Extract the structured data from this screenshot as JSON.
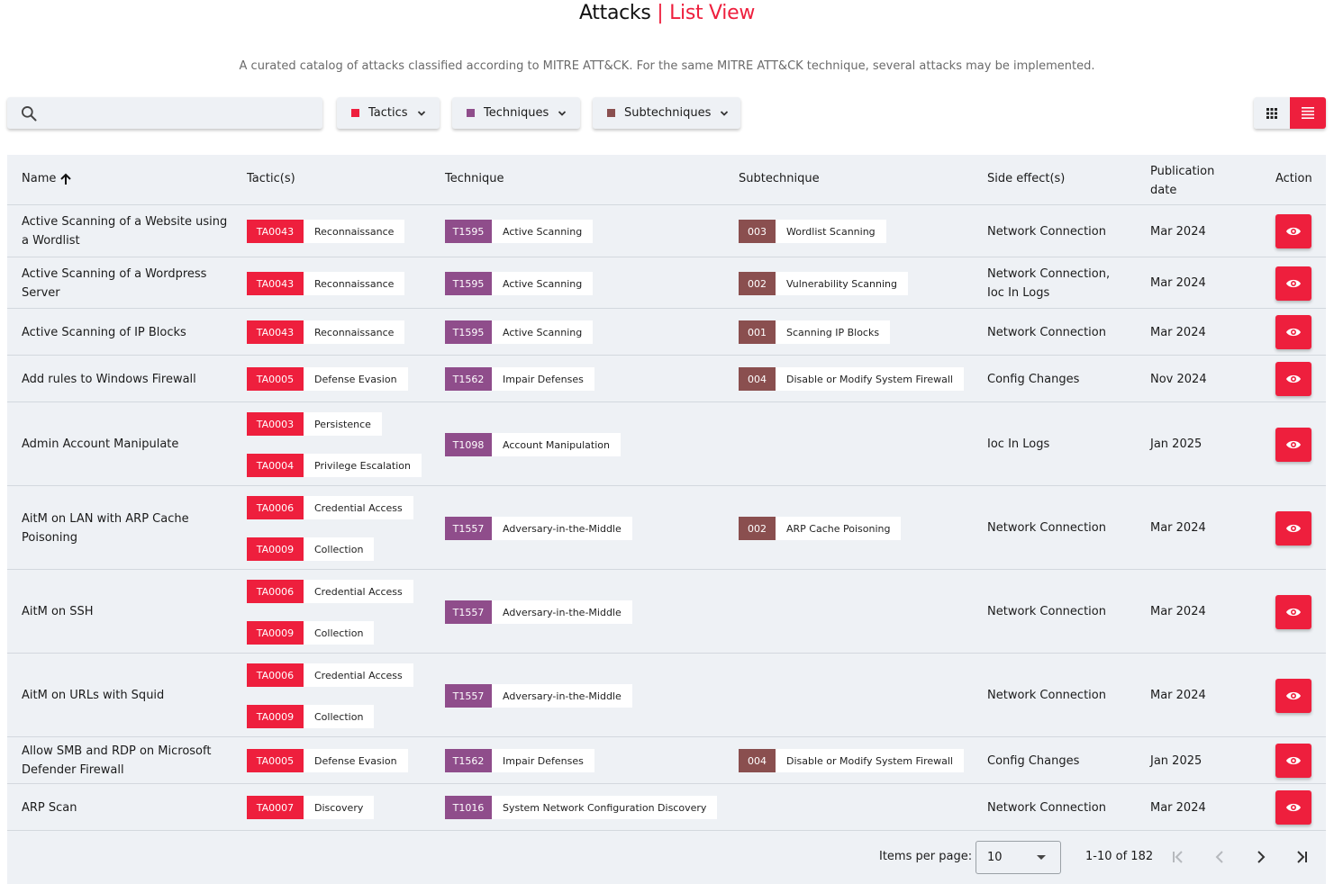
{
  "header": {
    "title_main": "Attacks",
    "title_sep": "|",
    "title_view": "List View",
    "subtitle": "A curated catalog of attacks classified according to MITRE ATT&CK. For the same MITRE ATT&CK technique, several attacks may be implemented."
  },
  "search": {
    "placeholder": "",
    "value": "",
    "icon": "search-icon"
  },
  "filters": [
    {
      "label": "Tactics",
      "color": "#ee1f3d"
    },
    {
      "label": "Techniques",
      "color": "#8f4d8b"
    },
    {
      "label": "Subtechniques",
      "color": "#8a4f4f"
    }
  ],
  "view_toggle": {
    "grid_icon": "grid-icon",
    "list_icon": "list-icon",
    "active": "list"
  },
  "colors": {
    "accent": "#ee1f3d",
    "tactic": "#ee1f3d",
    "technique": "#8f4d8b",
    "subtechnique": "#8a4f4f",
    "table_bg": "#eef1f5"
  },
  "table": {
    "columns": {
      "name": "Name",
      "tactics": "Tactic(s)",
      "technique": "Technique",
      "subtechnique": "Subtechnique",
      "side_effects": "Side effect(s)",
      "publication_1": "Publication",
      "publication_2": "date",
      "action": "Action"
    },
    "sort": {
      "column": "Name",
      "direction": "ascending"
    },
    "rows": [
      {
        "name1": "Active Scanning of a Website using",
        "name2": "a Wordlist",
        "tactics": [
          {
            "code": "TA0043",
            "label": "Reconnaissance"
          }
        ],
        "technique": {
          "code": "T1595",
          "label": "Active Scanning"
        },
        "subtechnique": {
          "code": "003",
          "label": "Wordlist Scanning"
        },
        "side1": "Network Connection",
        "side2": "",
        "date": "Mar 2024"
      },
      {
        "name1": "Active Scanning of a Wordpress",
        "name2": "Server",
        "tactics": [
          {
            "code": "TA0043",
            "label": "Reconnaissance"
          }
        ],
        "technique": {
          "code": "T1595",
          "label": "Active Scanning"
        },
        "subtechnique": {
          "code": "002",
          "label": "Vulnerability Scanning"
        },
        "side1": "Network Connection,",
        "side2": "Ioc In Logs",
        "date": "Mar 2024"
      },
      {
        "name1": "Active Scanning of IP Blocks",
        "name2": "",
        "tactics": [
          {
            "code": "TA0043",
            "label": "Reconnaissance"
          }
        ],
        "technique": {
          "code": "T1595",
          "label": "Active Scanning"
        },
        "subtechnique": {
          "code": "001",
          "label": "Scanning IP Blocks"
        },
        "side1": "Network Connection",
        "side2": "",
        "date": "Mar 2024"
      },
      {
        "name1": "Add rules to Windows Firewall",
        "name2": "",
        "tactics": [
          {
            "code": "TA0005",
            "label": "Defense Evasion"
          }
        ],
        "technique": {
          "code": "T1562",
          "label": "Impair Defenses"
        },
        "subtechnique": {
          "code": "004",
          "label": "Disable or Modify System Firewall"
        },
        "side1": "Config Changes",
        "side2": "",
        "date": "Nov 2024"
      },
      {
        "name1": "Admin Account Manipulate",
        "name2": "",
        "tactics": [
          {
            "code": "TA0003",
            "label": "Persistence"
          },
          {
            "code": "TA0004",
            "label": "Privilege Escalation"
          }
        ],
        "technique": {
          "code": "T1098",
          "label": "Account Manipulation"
        },
        "subtechnique": null,
        "side1": "Ioc In Logs",
        "side2": "",
        "date": "Jan 2025"
      },
      {
        "name1": "AitM on LAN with ARP Cache",
        "name2": "Poisoning",
        "tactics": [
          {
            "code": "TA0006",
            "label": "Credential Access"
          },
          {
            "code": "TA0009",
            "label": "Collection"
          }
        ],
        "technique": {
          "code": "T1557",
          "label": "Adversary-in-the-Middle"
        },
        "subtechnique": {
          "code": "002",
          "label": "ARP Cache Poisoning"
        },
        "side1": "Network Connection",
        "side2": "",
        "date": "Mar 2024"
      },
      {
        "name1": "AitM on SSH",
        "name2": "",
        "tactics": [
          {
            "code": "TA0006",
            "label": "Credential Access"
          },
          {
            "code": "TA0009",
            "label": "Collection"
          }
        ],
        "technique": {
          "code": "T1557",
          "label": "Adversary-in-the-Middle"
        },
        "subtechnique": null,
        "side1": "Network Connection",
        "side2": "",
        "date": "Mar 2024"
      },
      {
        "name1": "AitM on URLs with Squid",
        "name2": "",
        "tactics": [
          {
            "code": "TA0006",
            "label": "Credential Access"
          },
          {
            "code": "TA0009",
            "label": "Collection"
          }
        ],
        "technique": {
          "code": "T1557",
          "label": "Adversary-in-the-Middle"
        },
        "subtechnique": null,
        "side1": "Network Connection",
        "side2": "",
        "date": "Mar 2024"
      },
      {
        "name1": "Allow SMB and RDP on Microsoft",
        "name2": "Defender Firewall",
        "tactics": [
          {
            "code": "TA0005",
            "label": "Defense Evasion"
          }
        ],
        "technique": {
          "code": "T1562",
          "label": "Impair Defenses"
        },
        "subtechnique": {
          "code": "004",
          "label": "Disable or Modify System Firewall"
        },
        "side1": "Config Changes",
        "side2": "",
        "date": "Jan 2025"
      },
      {
        "name1": "ARP Scan",
        "name2": "",
        "tactics": [
          {
            "code": "TA0007",
            "label": "Discovery"
          }
        ],
        "technique": {
          "code": "T1016",
          "label": "System Network Configuration Discovery"
        },
        "subtechnique": null,
        "side1": "Network Connection",
        "side2": "",
        "date": "Mar 2024"
      }
    ]
  },
  "paginator": {
    "items_per_page_label": "Items per page:",
    "items_per_page_value": "10",
    "range_label": "1-10 of 182",
    "first_icon": "first-page-icon",
    "prev_icon": "chevron-left-icon",
    "next_icon": "chevron-right-icon",
    "last_icon": "last-page-icon"
  }
}
